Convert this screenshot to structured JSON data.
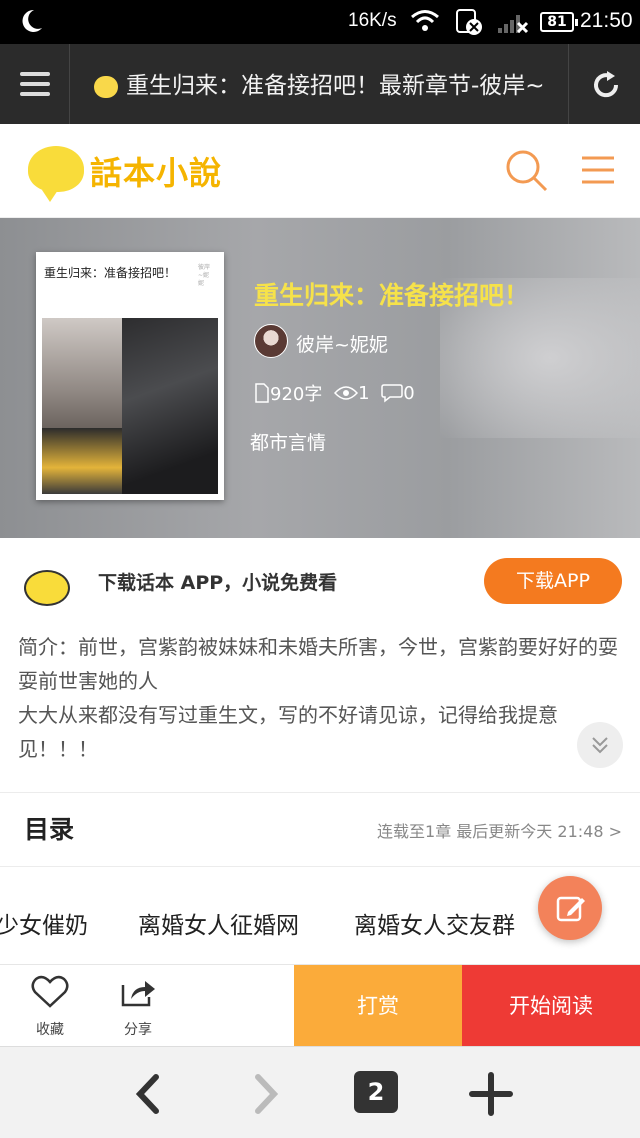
{
  "status_bar": {
    "speed": "16K/s",
    "battery": "81",
    "time": "21:50"
  },
  "browser": {
    "url_title": "重生归来：准备接招吧！最新章节-彼岸~",
    "tab_count": "2"
  },
  "site": {
    "logo_text": "話本小說"
  },
  "book": {
    "cover_title": "重生归来：准备接招吧！",
    "cover_tag": "彼岸~妮妮",
    "title": "重生归来：准备接招吧！",
    "author": "彼岸~妮妮",
    "word_count": "920字",
    "views": "1",
    "comments": "0",
    "genre": "都市言情"
  },
  "download": {
    "text": "下载话本 APP，小说免费看",
    "button_label": "下载APP"
  },
  "intro": {
    "line1": "简介：前世，宫紫韵被妹妹和未婚夫所害，今世，宫紫韵要好好的耍耍前世害她的人",
    "line2": "大大从来都没有写过重生文，写的不好请见谅，记得给我提意见！！！"
  },
  "catalog": {
    "heading": "目录",
    "meta": "连载至1章 最后更新今天 21:48 >"
  },
  "tags": [
    "少女催奶",
    "离婚女人征婚网",
    "离婚女人交友群"
  ],
  "actions": {
    "favorite": "收藏",
    "share": "分享",
    "reward": "打赏",
    "start_reading": "开始阅读"
  }
}
